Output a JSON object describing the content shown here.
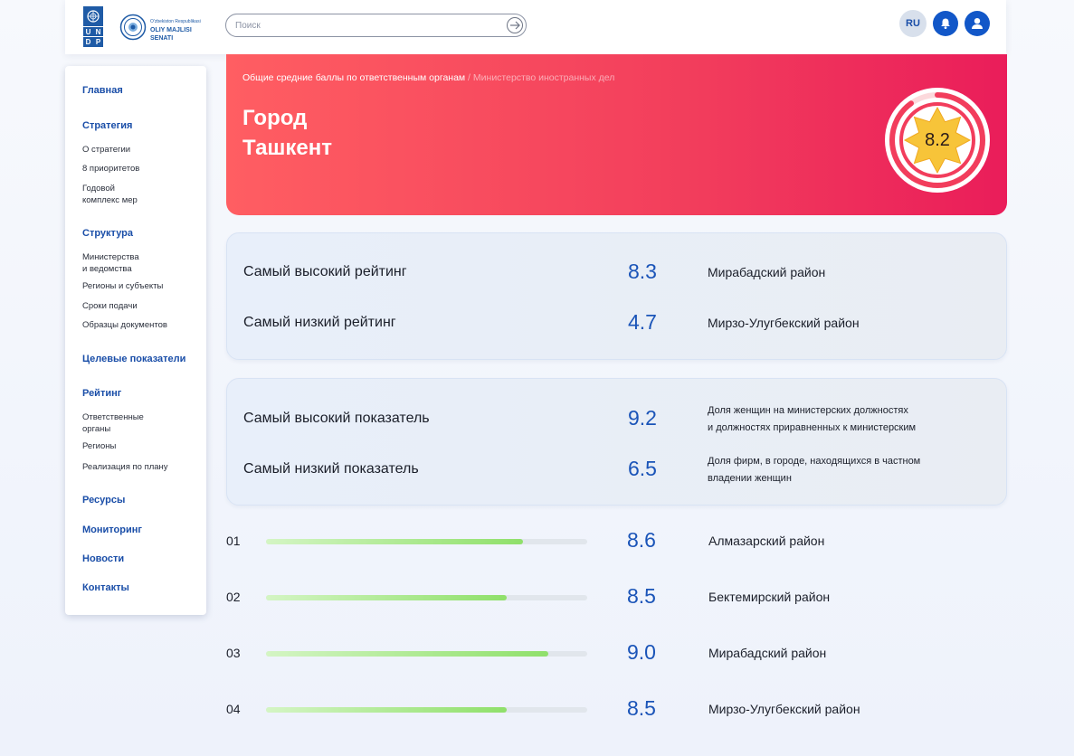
{
  "header": {
    "undp_letters": [
      "U",
      "N",
      "D",
      "P"
    ],
    "senate_small": "O'zbekiston Respublikasi",
    "senate_name": "OLIY MAJLISI",
    "senate_name2": "SENATI",
    "search": {
      "placeholder": "Поиск",
      "value": ""
    },
    "lang": "RU"
  },
  "sidebar": {
    "main": "Главная",
    "strategy": "Стратегия",
    "strategy_items": [
      "О стратегии",
      "8 приоритетов",
      "Годовой",
      "комплекс мер"
    ],
    "structure": "Структура",
    "structure_items": [
      "Министерства",
      "и ведомства",
      "Регионы и субъекты",
      "Сроки подачи",
      "Образцы документов"
    ],
    "targets": "Целевые показатели",
    "rating": "Рейтинг",
    "rating_items": [
      "Ответственные",
      "органы",
      "Регионы",
      "Реализация по плану"
    ],
    "resources": "Ресурсы",
    "monitoring": "Мониторинг",
    "news": "Новости",
    "contacts": "Контакты"
  },
  "hero": {
    "breadcrumb_parent": "Общие средние баллы по ответственным органам",
    "breadcrumb_sep": " / ",
    "breadcrumb_current": "Министерство иностранных дел",
    "title_line1": "Город",
    "title_line2": "Ташкент",
    "score": "8.2",
    "score_ring_fraction": 0.9
  },
  "rating_card": {
    "high_label": "Самый высокий рейтинг",
    "high_value": "8.3",
    "high_name": "Мирабадский район",
    "low_label": "Самый низкий рейтинг",
    "low_value": "4.7",
    "low_name": "Мирзо-Улугбекский район"
  },
  "indicator_card": {
    "high_label": "Самый высокий показатель",
    "high_value": "9.2",
    "high_desc_line1": "Доля женщин на министерских должностях",
    "high_desc_line2": "и должностях приравненных к министерским",
    "low_label": "Самый низкий показатель",
    "low_value": "6.5",
    "low_desc_line1": "Доля фирм, в городе, находящихся в частном",
    "low_desc_line2": "владении женщин"
  },
  "ranking": [
    {
      "num": "01",
      "value": "8.6",
      "name": "Алмазарский район",
      "fill": 0.8
    },
    {
      "num": "02",
      "value": "8.5",
      "name": "Бектемирский район",
      "fill": 0.75
    },
    {
      "num": "03",
      "value": "9.0",
      "name": "Мирабадский район",
      "fill": 0.88
    },
    {
      "num": "04",
      "value": "8.5",
      "name": "Мирзо-Улугбекский район",
      "fill": 0.75
    }
  ],
  "colors": {
    "accent_blue": "#1a54b8",
    "hero_start": "#ff5e62",
    "hero_end": "#ea1d5a",
    "progress_green": "#8fe06a",
    "star_yellow": "#f7c439"
  },
  "icons": {
    "search": "search-arrow-icon",
    "bell": "bell-icon",
    "user": "user-icon",
    "star": "star-badge-icon"
  }
}
